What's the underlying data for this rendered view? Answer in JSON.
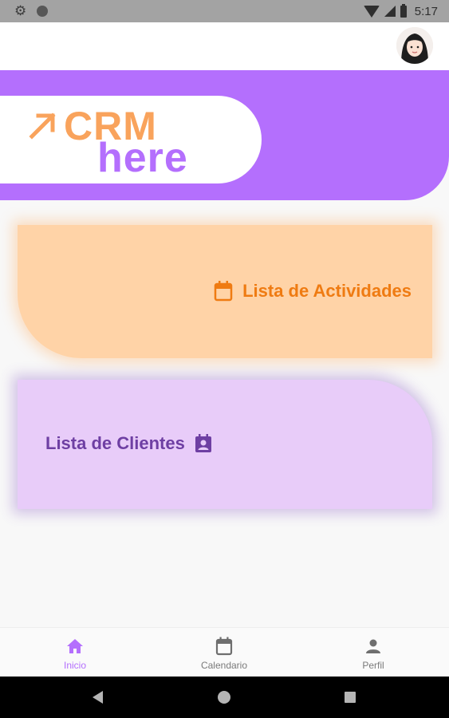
{
  "status_bar": {
    "time": "5:17",
    "icons": [
      "settings-icon",
      "circle-icon",
      "wifi-icon",
      "signal-icon",
      "battery-icon"
    ]
  },
  "app_bar": {
    "theme_icon": "moon-icon",
    "avatar": "user-avatar"
  },
  "hero": {
    "logo_top": "CRM",
    "logo_bottom": "here",
    "colors": {
      "purple": "#b46ffd",
      "orange": "#f9a35c"
    }
  },
  "cards": {
    "actividades": {
      "label": "Lista de Actividades",
      "icon": "calendar-icon",
      "bg": "#ffd3a7",
      "text_color": "#ef7b12"
    },
    "clientes": {
      "label": "Lista de Clientes",
      "icon": "contact-card-icon",
      "bg": "#e8ccf9",
      "text_color": "#6e3fa3"
    }
  },
  "bottom_nav": {
    "items": [
      {
        "label": "Inicio",
        "icon": "home-icon",
        "active": true
      },
      {
        "label": "Calendario",
        "icon": "calendar-icon",
        "active": false
      },
      {
        "label": "Perfil",
        "icon": "person-icon",
        "active": false
      }
    ]
  },
  "system_nav": {
    "icons": [
      "back-icon",
      "home-icon",
      "recents-icon"
    ]
  }
}
